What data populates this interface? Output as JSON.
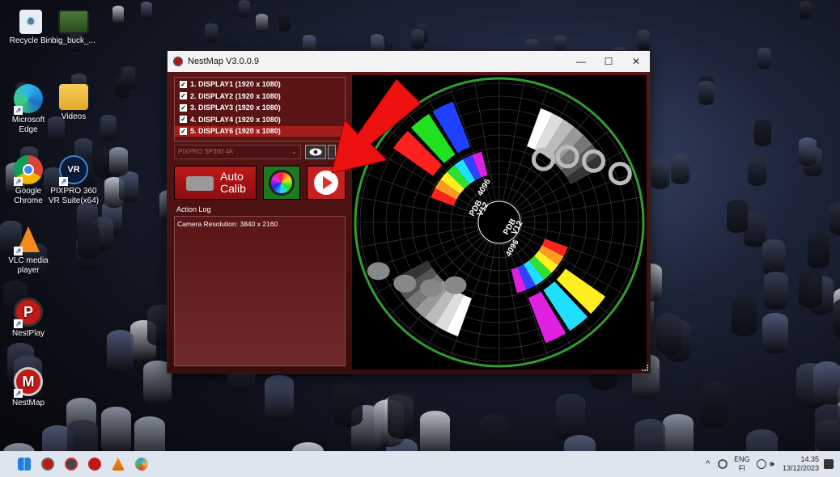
{
  "desktop": {
    "icons": [
      {
        "label": "Recycle Bin",
        "icon": "recycle-bin-icon"
      },
      {
        "label": "big_buck_...",
        "icon": "video-file-icon"
      },
      {
        "label": "Microsoft\nEdge",
        "icon": "edge-icon"
      },
      {
        "label": "Videos",
        "icon": "folder-icon"
      },
      {
        "label": "Google\nChrome",
        "icon": "chrome-icon"
      },
      {
        "label": "PIXPRO 360\nVR Suite(x64)",
        "icon": "pixpro-icon"
      },
      {
        "label": "VLC media\nplayer",
        "icon": "vlc-icon"
      },
      {
        "label": "NestPlay",
        "icon": "nestplay-icon"
      },
      {
        "label": "NestMap",
        "icon": "nestmap-icon"
      }
    ]
  },
  "window": {
    "title": "NestMap V3.0.0.9",
    "minimize": "—",
    "maximize": "☐",
    "close": "✕"
  },
  "displays": [
    {
      "label": "1. DISPLAY1 (1920 x 1080)",
      "checked": "✓"
    },
    {
      "label": "2. DISPLAY2 (1920 x 1080)",
      "checked": "✓"
    },
    {
      "label": "3. DISPLAY3 (1920 x 1080)",
      "checked": "✓"
    },
    {
      "label": "4. DISPLAY4 (1920 x 1080)",
      "checked": "✓"
    },
    {
      "label": "5. DISPLAY6 (1920 x 1080)",
      "checked": "✓"
    }
  ],
  "camera": {
    "selected": "PIXPRO SP360 4K",
    "chevron": "⌄"
  },
  "buttons": {
    "auto_calib_line1": "Auto",
    "auto_calib_line2": "Calib"
  },
  "log": {
    "label": "Action Log",
    "lines": [
      "Camera Resolution: 3840 x 2160"
    ]
  },
  "preview": {
    "labels": [
      "4096",
      "PDB",
      "V12",
      "4096",
      "PDB",
      "V12"
    ]
  },
  "taskbar": {
    "apps": [
      "windows-start-icon",
      "nestmap-taskbar-icon",
      "pixpro-taskbar-icon",
      "nestplay-taskbar-icon",
      "vlc-taskbar-icon",
      "paint-taskbar-icon"
    ],
    "chevron": "^",
    "lang_top": "ENG",
    "lang_bottom": "FI",
    "volume": "🕪",
    "time": "14.35",
    "date": "13/12/2023"
  },
  "colors": {
    "accent_red": "#c42020",
    "window_bg": "#4a1414",
    "ring_green": "#2ea02e"
  }
}
